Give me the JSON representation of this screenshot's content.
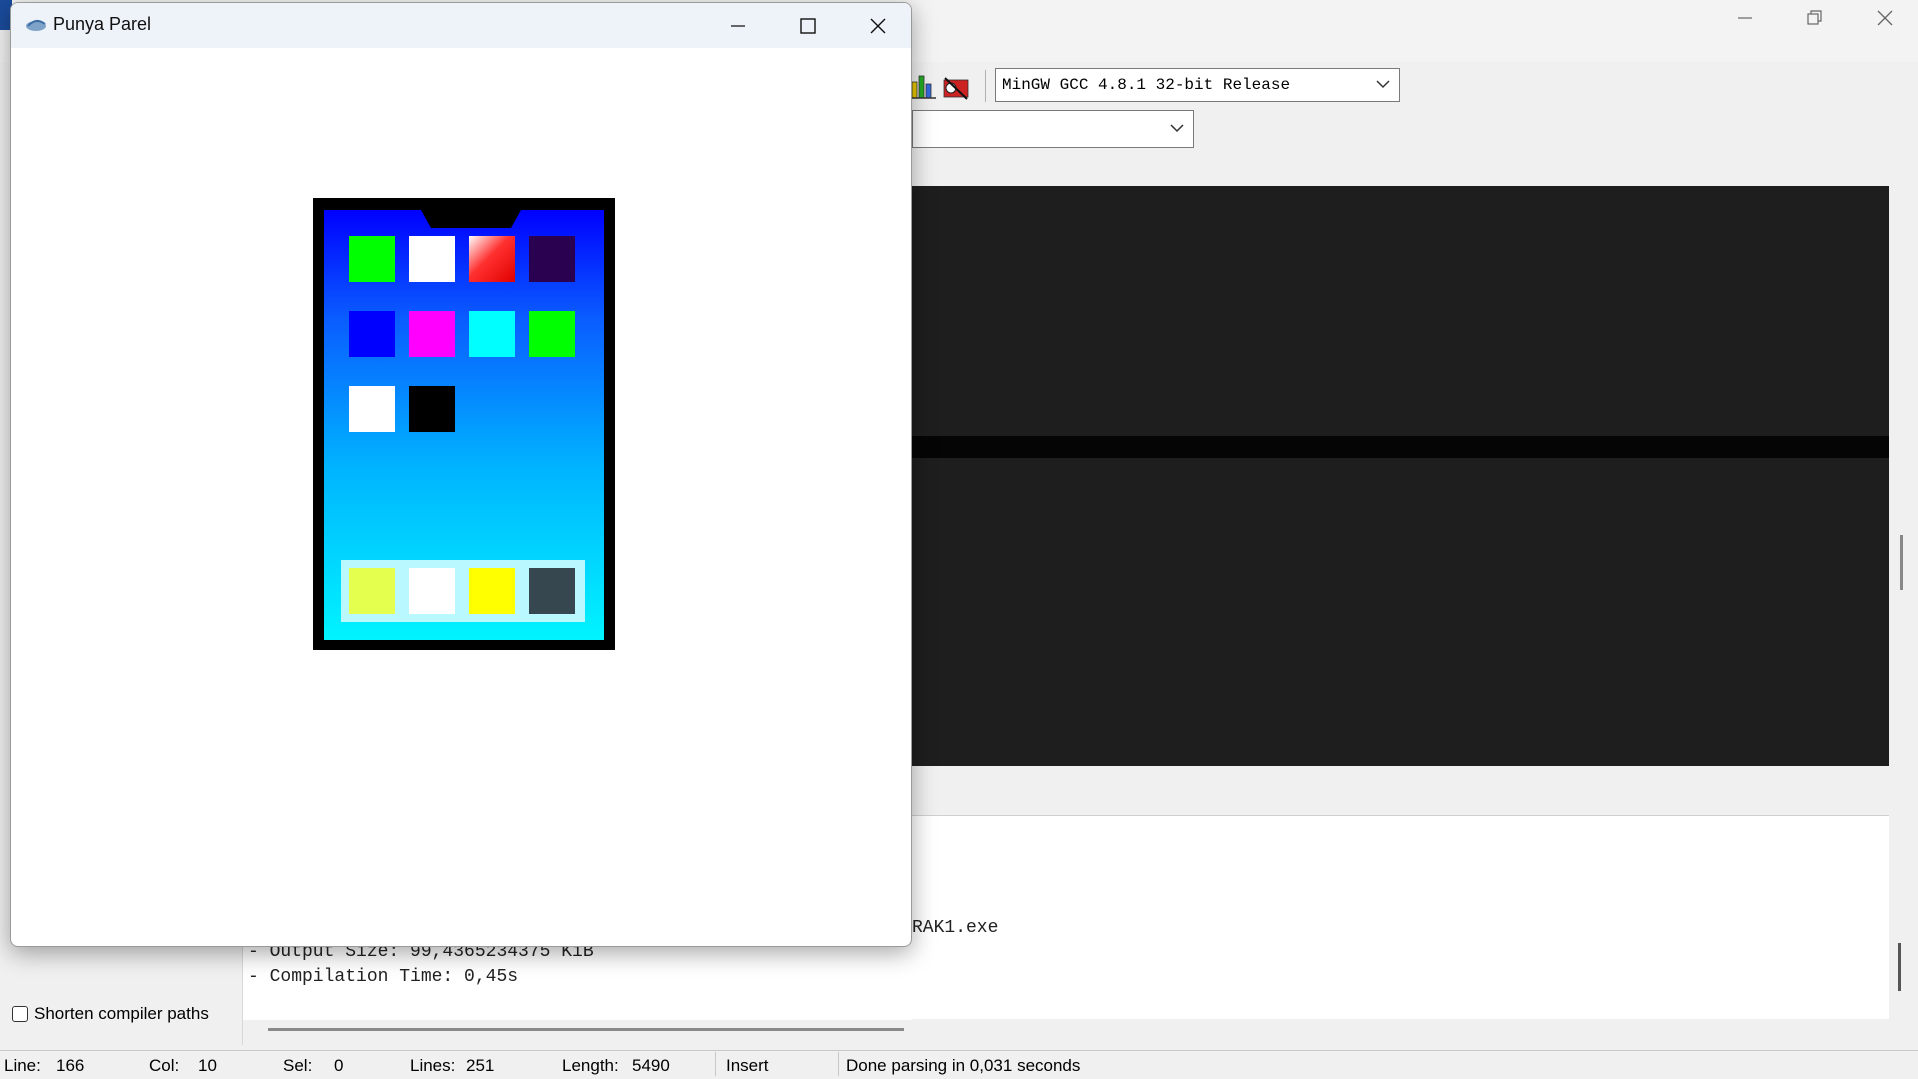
{
  "ide": {
    "compiler_select": "MinGW GCC 4.8.1 32-bit Release",
    "log": {
      "exe_fragment": "RAK1.exe",
      "output_size": "- Output Size: 99,4365234375 KiB",
      "compilation_time": "- Compilation Time: 0,45s"
    },
    "shorten_compiler_paths": "Shorten compiler paths",
    "status": {
      "line_label": "Line:",
      "line_value": "166",
      "col_label": "Col:",
      "col_value": "10",
      "sel_label": "Sel:",
      "sel_value": "0",
      "lines_label": "Lines:",
      "lines_value": "251",
      "length_label": "Length:",
      "length_value": "5490",
      "mode": "Insert",
      "message": "Done parsing in 0,031 seconds"
    }
  },
  "window": {
    "title": "Punya Parel",
    "icons": {
      "title": "app-icon",
      "minimize": "minimize-icon",
      "maximize": "maximize-icon",
      "close": "close-icon"
    }
  },
  "phone": {
    "frame_color": "#000000",
    "app_grid": [
      [
        "#00ff00",
        "#ffffff",
        "#ff0000",
        "#2a0050"
      ],
      [
        "#0000ff",
        "#ff00ff",
        "#00ffff",
        "#00ff00"
      ],
      [
        "#ffffff",
        "#000000"
      ]
    ],
    "dock": [
      "#e4ff4d",
      "#ffffff",
      "#ffff00",
      "#37474f"
    ]
  }
}
